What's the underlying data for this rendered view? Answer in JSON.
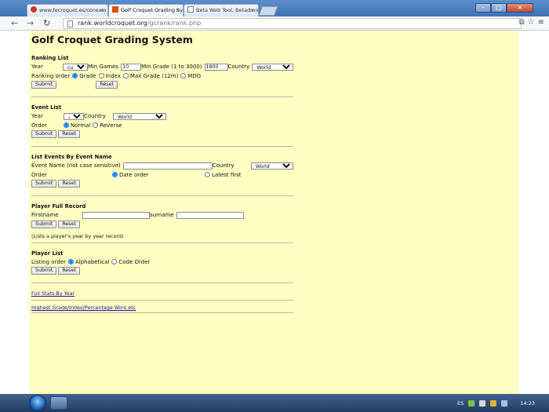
{
  "browser": {
    "tabs": [
      {
        "label": "www.fecroquet.es/conexio",
        "active": false
      },
      {
        "label": "Golf Croquet Grading Sys",
        "active": true
      },
      {
        "label": "Beta Web Tool, Betadmin",
        "active": false
      }
    ],
    "tab_close_glyph": "×",
    "url": "rank.worldcroquet.org",
    "url_path": "/gcrank/rank.php",
    "colors": {
      "tabbar": "#4a7dbf",
      "page_background": "#ffffc4",
      "link": "#1a0dab"
    },
    "icons": [
      "back-arrow-icon",
      "forward-arrow-icon",
      "reload-icon",
      "page-icon",
      "translate-icon",
      "star-icon",
      "menu-icon"
    ]
  },
  "page": {
    "title": "Golf Croquet Grading System",
    "ranking_list": {
      "heading": "Ranking List",
      "year_label": "Year",
      "year_value": "current",
      "min_games_label": "Min Games",
      "min_games_value": "10",
      "min_grade_label": "Min Grade (1 to 3000)",
      "min_grade_value": "1800",
      "country_label": "Country",
      "country_value": "World",
      "order_label": "Ranking order",
      "options": [
        "Grade",
        "Index",
        "Max Grade (12m)",
        "MDG"
      ],
      "selected": "Grade",
      "submit": "Submit",
      "reset": "Reset"
    },
    "event_list": {
      "heading": "Event List",
      "year_label": "Year",
      "year_value": "2016",
      "country_label": "Country",
      "country_value": "World",
      "order_label": "Order",
      "options": [
        "Normal",
        "Reverse"
      ],
      "selected": "Normal",
      "submit": "Submit",
      "reset": "Reset"
    },
    "events_by_name": {
      "heading": "List Events By Event Name",
      "name_label": "Event Name (not case sensitive)",
      "name_value": "",
      "country_label": "Country",
      "country_value": "World",
      "order_label": "Order",
      "options": [
        "Date order",
        "Latest first"
      ],
      "selected": "Date order",
      "submit": "Submit",
      "reset": "Reset"
    },
    "player_record": {
      "heading": "Player Full Record",
      "firstname_label": "Firstname",
      "surname_label": "surname",
      "submit": "Submit",
      "reset": "Reset",
      "note": "(Lists a player's year by year record)"
    },
    "player_list": {
      "heading": "Player List",
      "order_label": "Listing order",
      "options": [
        "Alphabetical",
        "Code Order"
      ],
      "selected": "Alphabetical",
      "submit": "Submit",
      "reset": "Reset"
    },
    "links": {
      "full_stats": "Full Stats By Year",
      "highest_grade": "Highest Grade/Index/Percentage Wins etc"
    }
  },
  "taskbar": {
    "language": "ES",
    "time": "14:23"
  }
}
